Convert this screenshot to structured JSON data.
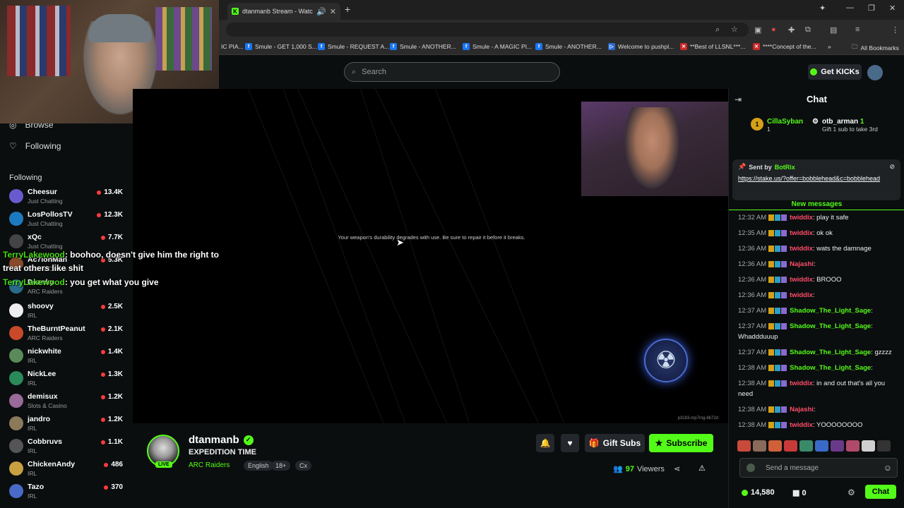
{
  "browser": {
    "tab_title": "dtanmanb Stream - Watch L",
    "bookmarks": [
      "IC PIA...",
      "Smule - GET 1,000 S...",
      "Smule - REQUEST A...",
      "Smule - ANOTHER...",
      "Smule - A MAGIC PI...",
      "Smule - ANOTHER...",
      "Welcome to pushpl...",
      "**Best of LLSNL***...",
      "****Concept of the...",
      "All Bookmarks"
    ]
  },
  "header": {
    "search_placeholder": "Search",
    "get_kicks": "Get KICKs"
  },
  "sidebar": {
    "browse": "Browse",
    "following_nav": "Following",
    "following_header": "Following",
    "channels": [
      {
        "name": "Cheesur",
        "category": "Just Chatting",
        "viewers": "13.4K",
        "color": "#6a5acd"
      },
      {
        "name": "LosPollosTV",
        "category": "Just Chatting",
        "viewers": "12.3K",
        "color": "#1e7abf"
      },
      {
        "name": "xQc",
        "category": "Just Chatting",
        "viewers": "7.7K",
        "color": "#444"
      },
      {
        "name": "Ac7ionMan",
        "category": "Slots & Casino",
        "viewers": "5.3K",
        "color": "#8a4a2a"
      },
      {
        "name": "Deanky",
        "category": "ARC Raiders",
        "viewers": "",
        "color": "#2a6a8a"
      },
      {
        "name": "shoovy",
        "category": "IRL",
        "viewers": "2.5K",
        "color": "#eee"
      },
      {
        "name": "TheBurntPeanut",
        "category": "ARC Raiders",
        "viewers": "2.1K",
        "color": "#c84a2a"
      },
      {
        "name": "nickwhite",
        "category": "IRL",
        "viewers": "1.4K",
        "color": "#5a8a5a"
      },
      {
        "name": "NickLee",
        "category": "IRL",
        "viewers": "1.3K",
        "color": "#2a8a5a"
      },
      {
        "name": "demisux",
        "category": "Slots & Casino",
        "viewers": "1.2K",
        "color": "#9a6a9a"
      },
      {
        "name": "jandro",
        "category": "IRL",
        "viewers": "1.2K",
        "color": "#8a7a5a"
      },
      {
        "name": "Cobbruvs",
        "category": "IRL",
        "viewers": "1.1K",
        "color": "#555"
      },
      {
        "name": "ChickenAndy",
        "category": "IRL",
        "viewers": "486",
        "color": "#c8a040"
      },
      {
        "name": "Tazo",
        "category": "IRL",
        "viewers": "370",
        "color": "#4a6ac8"
      }
    ]
  },
  "overlay_chat": [
    {
      "user": "TerryLakewood",
      "text": ": boohoo, doesn't give him the right to treat others like shit"
    },
    {
      "user": "TerryLakewood",
      "text": ": you get what you give"
    }
  ],
  "player": {
    "game_message": "Your weapon's durability degrades with use. Be sure to repair it before it breaks.",
    "session_id": "p3183-mp7mg-8b72d"
  },
  "stream": {
    "streamer": "dtanmanb",
    "live": "LIVE",
    "title": "EXPEDITION TIME",
    "category": "ARC Raiders",
    "tags": [
      "English",
      "18+",
      "Cx"
    ],
    "gift_subs": "Gift Subs",
    "subscribe": "Subscribe",
    "viewers": "97",
    "viewers_label": "Viewers"
  },
  "chat": {
    "title": "Chat",
    "leaders": [
      {
        "name": "CillaSyban",
        "sub": "1"
      },
      {
        "name": "otb_arman",
        "sub": "1",
        "note": "Gift 1 sub to take 3rd"
      }
    ],
    "pinned_by": "Sent by",
    "pinned_user": "BotRix",
    "pinned_link": "https://stake.us/?offer=bobblehead&c=bobblehead",
    "new_messages": "New messages",
    "messages": [
      {
        "time": "12:32 AM",
        "user": "twiddix",
        "color": "#ff4d6a",
        "text": ": play it safe"
      },
      {
        "time": "12:35 AM",
        "user": "twiddix",
        "color": "#ff4d6a",
        "text": ": ok ok"
      },
      {
        "time": "12:36 AM",
        "user": "twiddix",
        "color": "#ff4d6a",
        "text": ": wats the damnage"
      },
      {
        "time": "12:36 AM",
        "user": "Najashi",
        "color": "#ff4d6a",
        "text": ":"
      },
      {
        "time": "12:36 AM",
        "user": "twiddix",
        "color": "#ff4d6a",
        "text": ": BROOO"
      },
      {
        "time": "12:36 AM",
        "user": "twiddix",
        "color": "#ff4d6a",
        "text": ":"
      },
      {
        "time": "12:37 AM",
        "user": "Shadow_The_Light_Sage",
        "color": "#53fc18",
        "text": ":"
      },
      {
        "time": "12:37 AM",
        "user": "Shadow_The_Light_Sage",
        "color": "#53fc18",
        "text": ": Whaddduuup"
      },
      {
        "time": "12:37 AM",
        "user": "Shadow_The_Light_Sage",
        "color": "#53fc18",
        "text": ": gzzzz"
      },
      {
        "time": "12:38 AM",
        "user": "Shadow_The_Light_Sage",
        "color": "#53fc18",
        "text": ":"
      },
      {
        "time": "12:38 AM",
        "user": "twiddix",
        "color": "#ff4d6a",
        "text": ": in and out that's all you need"
      },
      {
        "time": "12:38 AM",
        "user": "Najashi",
        "color": "#ff4d6a",
        "text": ":"
      },
      {
        "time": "12:38 AM",
        "user": "twiddix",
        "color": "#ff4d6a",
        "text": ": YOOOOOOOO"
      }
    ],
    "send_placeholder": "Send a message",
    "kicks_balance": "14,580",
    "zero_count": "0",
    "chat_button": "Chat"
  }
}
